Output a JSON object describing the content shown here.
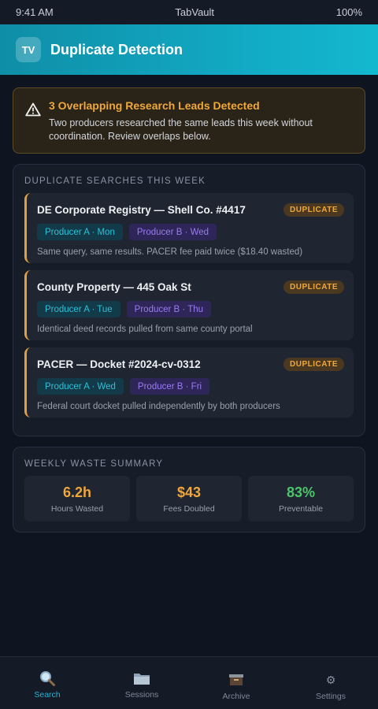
{
  "status_bar": {
    "time": "9:41 AM",
    "carrier": "TabVault",
    "battery": "100%"
  },
  "header": {
    "logo": "TV",
    "title": "Duplicate Detection"
  },
  "alert": {
    "icon": "warning-icon",
    "title": "3 Overlapping Research Leads Detected",
    "message": "Two producers researched the same leads this week without coordination. Review overlaps below."
  },
  "duplicates": {
    "section_title": "DUPLICATE SEARCHES THIS WEEK",
    "items": [
      {
        "title": "DE Corporate Registry — Shell Co. #4417",
        "badge": "DUPLICATE",
        "producer_a": "Producer A · Mon",
        "producer_b": "Producer B · Wed",
        "description": "Same query, same results. PACER fee paid twice ($18.40 wasted)"
      },
      {
        "title": "County Property — 445 Oak St",
        "badge": "DUPLICATE",
        "producer_a": "Producer A · Tue",
        "producer_b": "Producer B · Thu",
        "description": "Identical deed records pulled from same county portal"
      },
      {
        "title": "PACER — Docket #2024-cv-0312",
        "badge": "DUPLICATE",
        "producer_a": "Producer A · Wed",
        "producer_b": "Producer B · Fri",
        "description": "Federal court docket pulled independently by both producers"
      }
    ]
  },
  "waste_summary": {
    "section_title": "WEEKLY WASTE SUMMARY",
    "stats": [
      {
        "value": "6.2h",
        "label": "Hours Wasted",
        "color": "#f0a73a"
      },
      {
        "value": "$43",
        "label": "Fees Doubled",
        "color": "#f0a73a"
      },
      {
        "value": "83%",
        "label": "Preventable",
        "color": "#4cc56a"
      }
    ]
  },
  "nav": {
    "items": [
      {
        "label": "Search",
        "icon": "magnifier-icon",
        "active": true
      },
      {
        "label": "Sessions",
        "icon": "folder-icon",
        "active": false
      },
      {
        "label": "Archive",
        "icon": "archive-box-icon",
        "active": false
      },
      {
        "label": "Settings",
        "icon": "gear-icon",
        "active": false
      }
    ]
  },
  "colors": {
    "accent": "#13b8cf",
    "warning": "#f0a73a",
    "success": "#4cc56a",
    "producer_a": "#2cc0d8",
    "producer_b": "#9a7cf0"
  }
}
